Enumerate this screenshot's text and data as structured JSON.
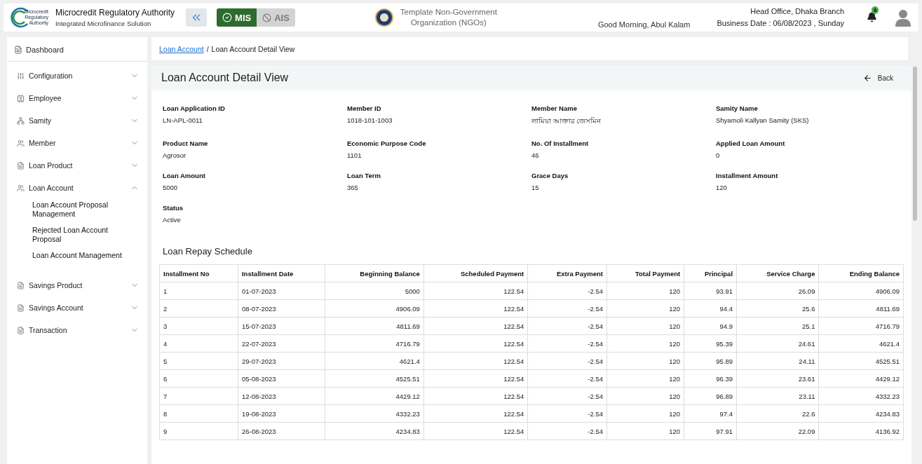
{
  "header": {
    "org_name": "Microcredit Regulatory Authority",
    "org_subtitle": "Integrated Microfinance Solution",
    "logo_text": [
      "Microcredit",
      "Regulatory",
      "Authority"
    ],
    "modules": [
      {
        "label": "MIS",
        "selected": true
      },
      {
        "label": "AIS",
        "selected": false
      }
    ],
    "organization": [
      "Template Non-Government",
      "Organization (NGOs)"
    ],
    "greeting": "Good Morning, Abul Kalam",
    "branch": "Head Office, Dhaka Branch",
    "business_date": "Business Date : 06/08/2023 , Sunday",
    "notification_count": "8"
  },
  "sidebar": {
    "dashboard": "Dashboard",
    "items": [
      {
        "label": "Configuration",
        "expanded": false
      },
      {
        "label": "Employee",
        "expanded": false
      },
      {
        "label": "Samity",
        "expanded": false
      },
      {
        "label": "Member",
        "expanded": false
      },
      {
        "label": "Loan Product",
        "expanded": false
      },
      {
        "label": "Loan Account",
        "expanded": true,
        "children": [
          {
            "label": "Loan Account Proposal Management"
          },
          {
            "label": "Rejected Loan Account Proposal"
          },
          {
            "label": "Loan Account Management"
          }
        ]
      },
      {
        "label": "Savings Product",
        "expanded": false
      },
      {
        "label": "Savings Account",
        "expanded": false
      },
      {
        "label": "Transaction",
        "expanded": false
      }
    ]
  },
  "breadcrumb": {
    "link": "Loan Account",
    "separator": "/",
    "current": "Loan Account Detail View"
  },
  "page_title": "Loan Account Detail View",
  "back_label": "Back",
  "details": [
    {
      "label": "Loan Application ID",
      "value": "LN-APL-0011"
    },
    {
      "label": "Member ID",
      "value": "1018-101-1003"
    },
    {
      "label": "Member Name",
      "value": "লামিয়া আক্তার জেসমিন"
    },
    {
      "label": "Samity Name",
      "value": "Shyamoli Kallyan Samity (SKS)"
    },
    {
      "label": "Product Name",
      "value": "Agrosor"
    },
    {
      "label": "Economic Purpose Code",
      "value": "1101"
    },
    {
      "label": "No. Of Installment",
      "value": "46"
    },
    {
      "label": "Applied Loan Amount",
      "value": "0"
    },
    {
      "label": "Loan Amount",
      "value": "5000"
    },
    {
      "label": "Loan Term",
      "value": "365"
    },
    {
      "label": "Grace Days",
      "value": "15"
    },
    {
      "label": "Installment Amount",
      "value": "120"
    },
    {
      "label": "Status",
      "value": "Active"
    }
  ],
  "schedule": {
    "title": "Loan Repay Schedule",
    "columns": [
      "Installment No",
      "Installment Date",
      "Beginning Balance",
      "Scheduled Payment",
      "Extra Payment",
      "Total Payment",
      "Principal",
      "Service Charge",
      "Ending Balance"
    ],
    "rows": [
      [
        "1",
        "01-07-2023",
        "5000",
        "122.54",
        "-2.54",
        "120",
        "93.91",
        "26.09",
        "4906.09"
      ],
      [
        "2",
        "08-07-2023",
        "4906.09",
        "122.54",
        "-2.54",
        "120",
        "94.4",
        "25.6",
        "4811.69"
      ],
      [
        "3",
        "15-07-2023",
        "4811.69",
        "122.54",
        "-2.54",
        "120",
        "94.9",
        "25.1",
        "4716.79"
      ],
      [
        "4",
        "22-07-2023",
        "4716.79",
        "122.54",
        "-2.54",
        "120",
        "95.39",
        "24.61",
        "4621.4"
      ],
      [
        "5",
        "29-07-2023",
        "4621.4",
        "122.54",
        "-2.54",
        "120",
        "95.89",
        "24.11",
        "4525.51"
      ],
      [
        "6",
        "05-08-2023",
        "4525.51",
        "122.54",
        "-2.54",
        "120",
        "96.39",
        "23.61",
        "4429.12"
      ],
      [
        "7",
        "12-08-2023",
        "4429.12",
        "122.54",
        "-2.54",
        "120",
        "96.89",
        "23.11",
        "4332.23"
      ],
      [
        "8",
        "19-08-2023",
        "4332.23",
        "122.54",
        "-2.54",
        "120",
        "97.4",
        "22.6",
        "4234.83"
      ],
      [
        "9",
        "26-08-2023",
        "4234.83",
        "122.54",
        "-2.54",
        "120",
        "97.91",
        "22.09",
        "4136.92"
      ]
    ]
  }
}
